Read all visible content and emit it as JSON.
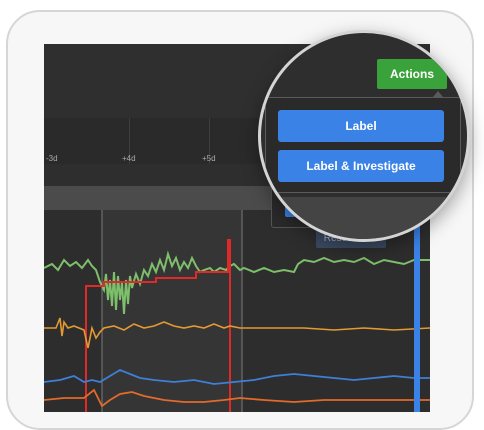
{
  "actions": {
    "button_label": "Actions",
    "menu": [
      {
        "label": "Label"
      },
      {
        "label": "Label & Investigate"
      }
    ]
  },
  "timeline": {
    "ticks": [
      "-3d",
      "+4d",
      "+5d"
    ]
  },
  "chart": {
    "reset_zoom_label": "Reset Zoom"
  },
  "colors": {
    "actions_green": "#3aa23a",
    "menu_blue": "#3b82e6",
    "series_green": "#7dbf6a",
    "series_orange": "#e39a33",
    "series_blue": "#3f7fd6",
    "series_red_orange": "#e26a2a",
    "marker_red": "#e02a2a"
  }
}
